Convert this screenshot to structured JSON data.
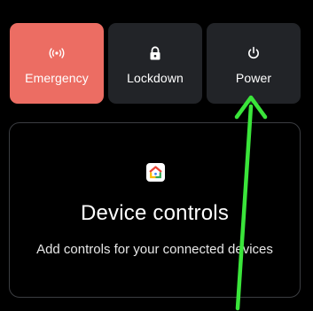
{
  "power_menu": {
    "emergency": {
      "label": "Emergency",
      "icon": "emergency-broadcast-icon",
      "color": "#ec6d63"
    },
    "lockdown": {
      "label": "Lockdown",
      "icon": "lock-icon"
    },
    "power": {
      "label": "Power",
      "icon": "power-icon"
    },
    "tile_color": "#222428"
  },
  "device_controls": {
    "icon": "google-home-icon",
    "title": "Device controls",
    "subtitle": "Add controls for your connected devices"
  },
  "annotation": {
    "icon": "green-arrow-pointing-up",
    "color": "#3ae53a"
  }
}
